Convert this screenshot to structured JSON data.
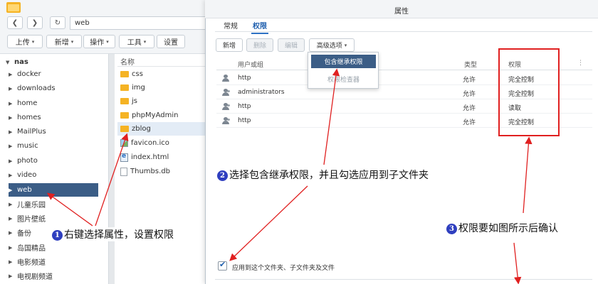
{
  "file_manager": {
    "path": "web",
    "toolbar": [
      "上传",
      "新增",
      "操作",
      "工具",
      "设置"
    ],
    "tree_root": "nas",
    "tree": [
      "docker",
      "downloads",
      "home",
      "homes",
      "MailPlus",
      "music",
      "photo",
      "video",
      "web",
      "儿童乐园",
      "图片壁纸",
      "备份",
      "岛国精品",
      "电影频道",
      "电视剧频道"
    ],
    "selected_tree_item": "web",
    "files_header": "名称",
    "files": [
      {
        "name": "css",
        "type": "folder"
      },
      {
        "name": "img",
        "type": "folder"
      },
      {
        "name": "js",
        "type": "folder"
      },
      {
        "name": "phpMyAdmin",
        "type": "folder"
      },
      {
        "name": "zblog",
        "type": "folder"
      },
      {
        "name": "favicon.ico",
        "type": "image"
      },
      {
        "name": "index.html",
        "type": "html"
      },
      {
        "name": "Thumbs.db",
        "type": "file"
      }
    ]
  },
  "dialog": {
    "title": "属性",
    "tabs": [
      "常规",
      "权限"
    ],
    "active_tab": "权限",
    "buttons": {
      "add": "新增",
      "delete": "删除",
      "edit": "编辑",
      "advanced": "高级选项"
    },
    "menu": {
      "inherit": "包含继承权限",
      "checker": "权限检查器"
    },
    "columns": {
      "user": "用户或组",
      "type": "类型",
      "perm": "权限"
    },
    "rows": [
      {
        "name": "http",
        "icon": "user",
        "type": "允许",
        "perm": "完全控制"
      },
      {
        "name": "administrators",
        "icon": "group",
        "type": "允许",
        "perm": "完全控制"
      },
      {
        "name": "http",
        "icon": "group",
        "type": "允许",
        "perm": "读取"
      },
      {
        "name": "http",
        "icon": "group",
        "type": "允许",
        "perm": "完全控制"
      }
    ],
    "apply_label": "应用到这个文件夹、子文件夹及文件",
    "apply_checked": true
  },
  "annotations": {
    "n1": "1",
    "a1": "右键选择属性，设置权限",
    "n2": "2",
    "a2": "选择包含继承权限，并且勾选应用到子文件夹",
    "n3": "3",
    "a3": "权限要如图所示后确认"
  },
  "colors": {
    "accent": "#3b5d86",
    "annotation_red": "#e02020",
    "badge": "#2f3fbf"
  }
}
